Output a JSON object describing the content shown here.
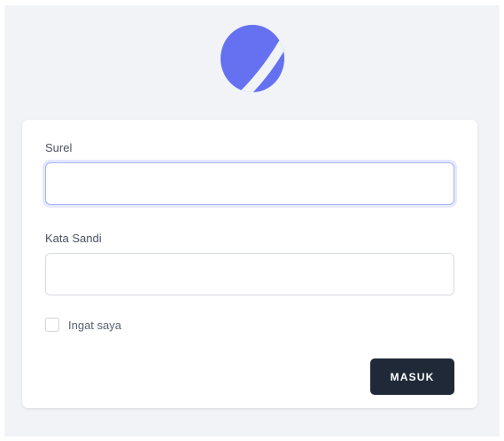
{
  "logo": {
    "icon": "planet-logo-icon",
    "color": "#6571f0"
  },
  "form": {
    "email": {
      "label": "Surel",
      "value": "",
      "placeholder": ""
    },
    "password": {
      "label": "Kata Sandi",
      "value": "",
      "placeholder": ""
    },
    "remember": {
      "label": "Ingat saya",
      "checked": false
    },
    "submit_label": "MASUK"
  },
  "colors": {
    "accent": "#6571f0",
    "button_bg": "#1f2937",
    "page_bg": "#f1f3f6",
    "focus_ring": "#a5b4fc"
  }
}
